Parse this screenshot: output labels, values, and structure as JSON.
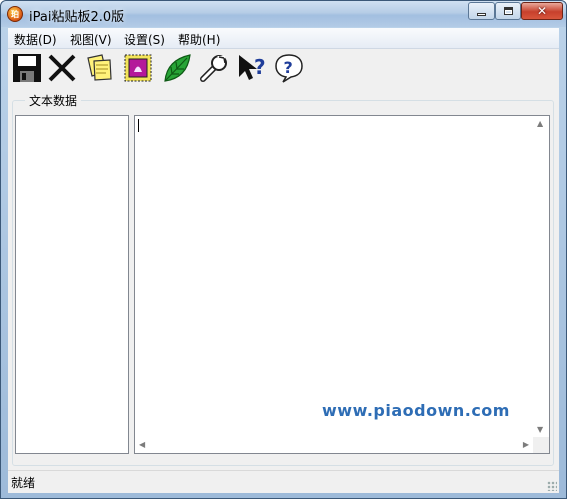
{
  "window": {
    "title": "iPai粘贴板2.0版",
    "icon": "app-logo-icon"
  },
  "caption_buttons": [
    "minimize-icon",
    "maximize-icon",
    "close-icon"
  ],
  "menu": [
    {
      "label": "数据(D)"
    },
    {
      "label": "视图(V)"
    },
    {
      "label": "设置(S)"
    },
    {
      "label": "帮助(H)"
    }
  ],
  "toolbar": [
    {
      "icon": "floppy-disk-save-icon"
    },
    {
      "icon": "delete-x-icon"
    },
    {
      "icon": "sticky-notes-icon"
    },
    {
      "icon": "stamp-icon"
    },
    {
      "icon": "green-leaf-icon"
    },
    {
      "icon": "wrench-settings-icon"
    },
    {
      "icon": "context-help-cursor-icon"
    },
    {
      "icon": "help-bubble-icon"
    }
  ],
  "group": {
    "label": "文本数据"
  },
  "list_items": [],
  "text_content": "",
  "watermark": "www.piaodown.com",
  "status": {
    "text": "就绪"
  },
  "colors": {
    "title_bar": "#b6cde6",
    "close_button": "#c7402c",
    "watermark": "#2e6db5"
  }
}
